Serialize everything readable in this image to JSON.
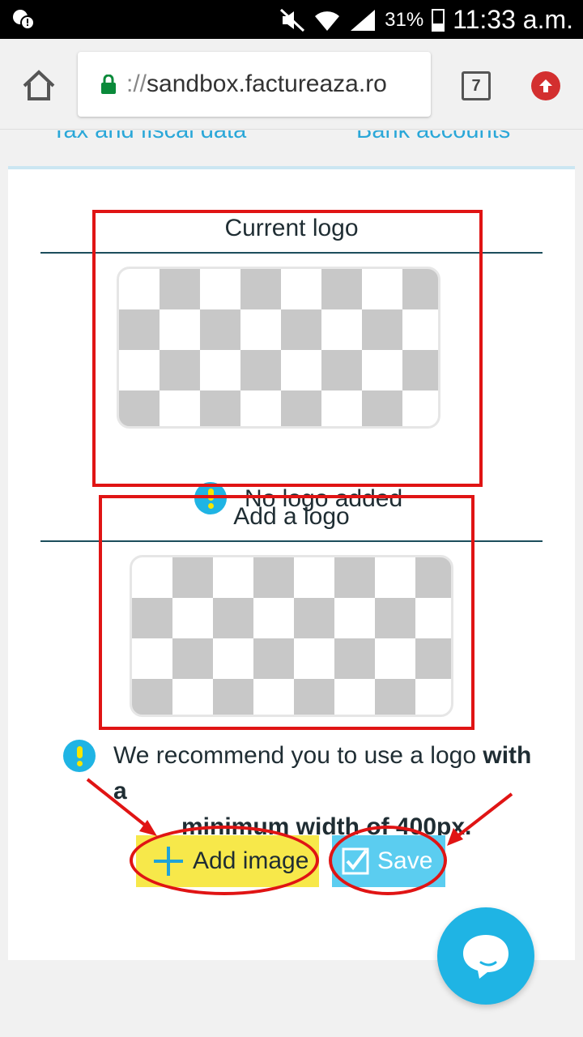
{
  "status_bar": {
    "battery": "31%",
    "time": "11:33 a.m."
  },
  "browser": {
    "url_scheme": "://",
    "url_host": "sandbox.factureaza.ro",
    "tab_count": "7"
  },
  "tabs": {
    "tax": "Tax and fiscal data",
    "bank": "Bank accounts"
  },
  "current_logo": {
    "title": "Current logo",
    "status": "No logo added"
  },
  "add_logo": {
    "title": "Add a logo"
  },
  "recommendation": {
    "text": "We recommend you to use a logo ",
    "bold_1": "with a",
    "bold_2": "minimum width of 400px."
  },
  "buttons": {
    "add_image": "Add image",
    "save": "Save"
  },
  "colors": {
    "accent": "#1fb4e4",
    "highlight": "#e01414",
    "add_button": "#f7e84a",
    "save_button": "#5bcdf0"
  }
}
